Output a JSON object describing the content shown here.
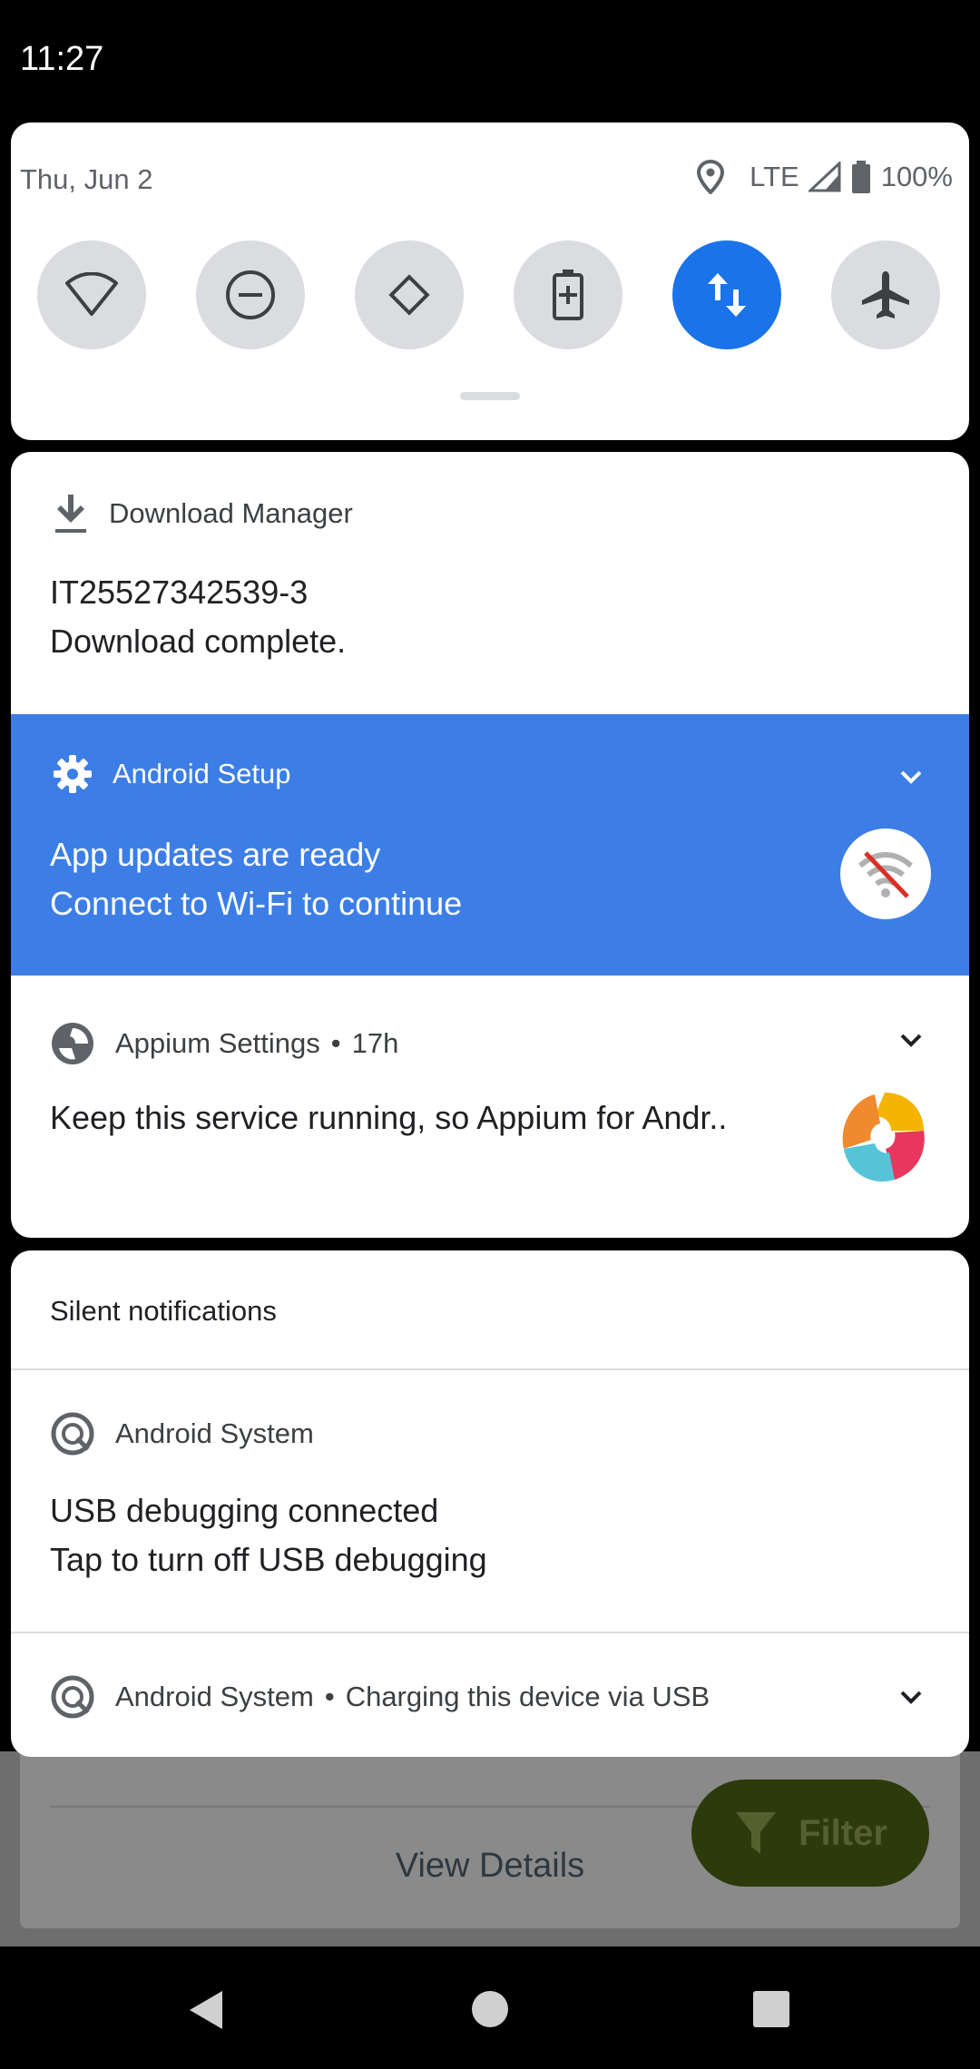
{
  "status_bar": {
    "time": "11:27"
  },
  "quick_settings": {
    "date": "Thu, Jun 2",
    "network": "LTE",
    "battery": "100%",
    "tiles": [
      {
        "name": "wifi-icon",
        "active": false
      },
      {
        "name": "do-not-disturb-icon",
        "active": false
      },
      {
        "name": "auto-rotate-icon",
        "active": false
      },
      {
        "name": "battery-saver-icon",
        "active": false
      },
      {
        "name": "mobile-data-icon",
        "active": true
      },
      {
        "name": "airplane-mode-icon",
        "active": false
      }
    ]
  },
  "notifications": {
    "download": {
      "app": "Download Manager",
      "title": "IT25527342539-3",
      "text": "Download complete."
    },
    "setup": {
      "app": "Android Setup",
      "title": "App updates are ready",
      "text": "Connect to Wi-Fi to continue"
    },
    "appium": {
      "app": "Appium Settings",
      "time": "17h",
      "text": "Keep this service running, so Appium for Andr.."
    }
  },
  "silent": {
    "header": "Silent notifications",
    "usb_debugging": {
      "app": "Android System",
      "title": "USB debugging connected",
      "text": "Tap to turn off USB debugging"
    },
    "charging": {
      "app": "Android System",
      "text": "Charging this device via USB"
    }
  },
  "background": {
    "view_details": "View Details",
    "filter": "Filter"
  },
  "colors": {
    "accent": "#1a73e8",
    "setup_bg": "#3c7ee6"
  }
}
